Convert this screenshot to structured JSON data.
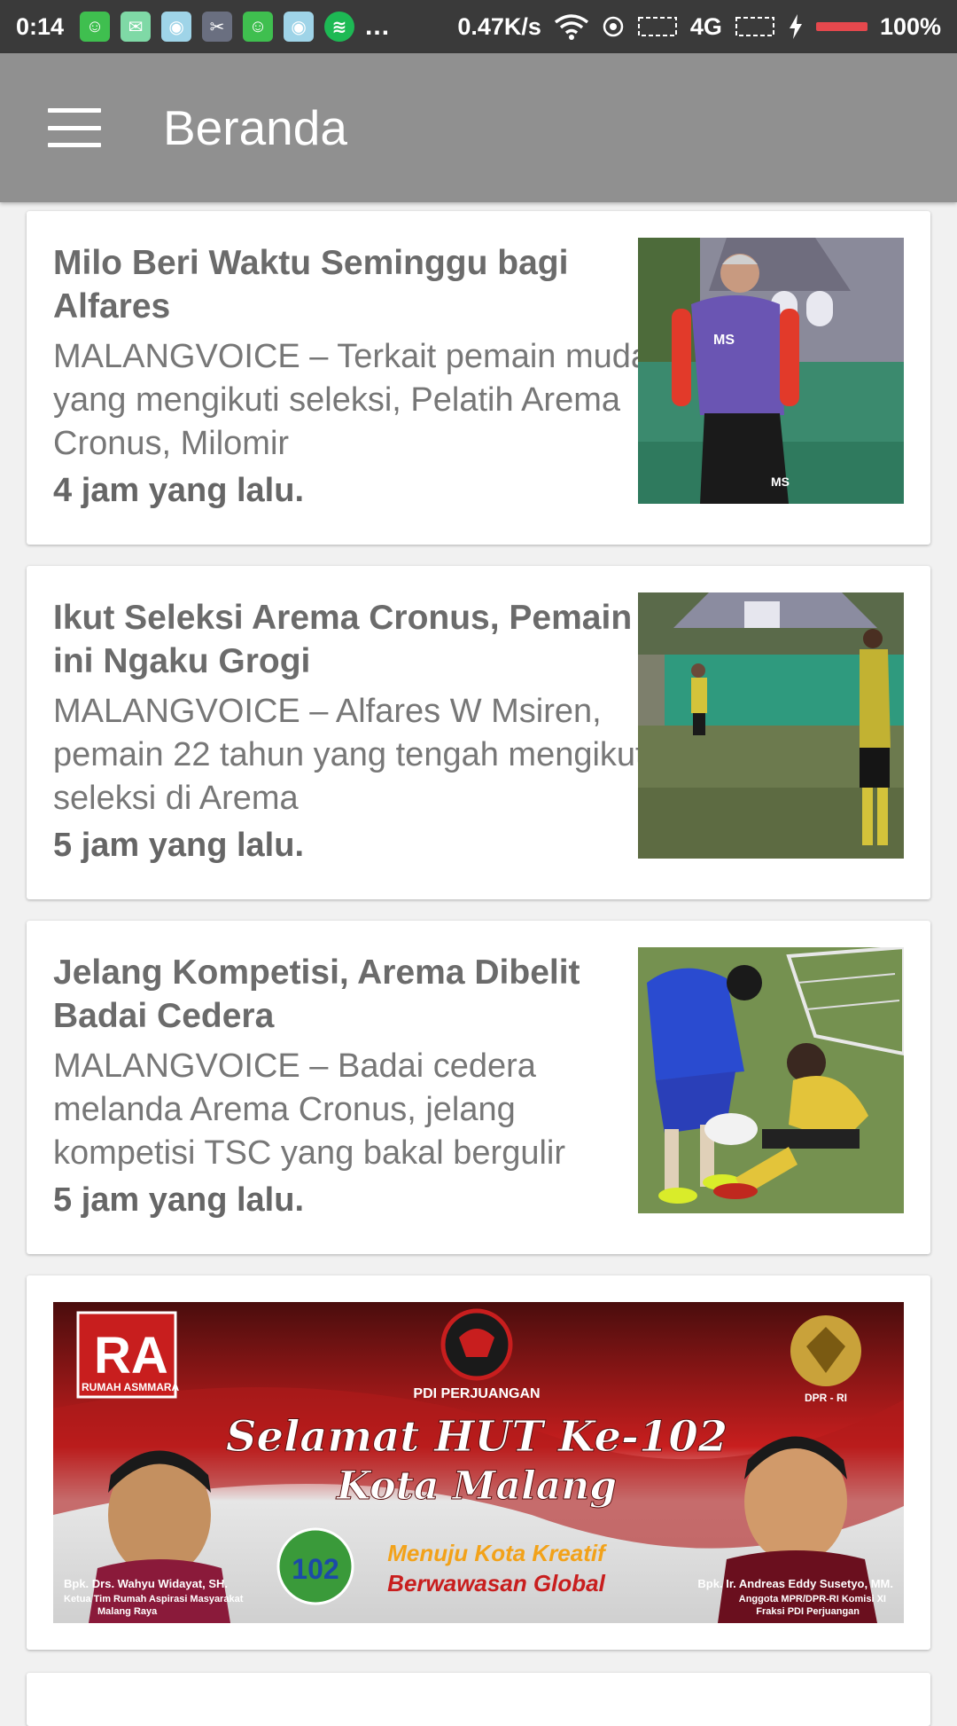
{
  "status_bar": {
    "time": "0:14",
    "net_speed": "0.47K/s",
    "network": "4G",
    "battery": "100%",
    "more": "..."
  },
  "app_bar": {
    "title": "Beranda"
  },
  "articles": [
    {
      "title": "Milo Beri Waktu Seminggu bagi Alfares",
      "excerpt": "MALANGVOICE – Terkait pemain muda yang mengikuti seleksi, Pelatih Arema Cronus, Milomir",
      "time": "4 jam yang lalu."
    },
    {
      "title": "Ikut Seleksi Arema Cronus, Pemain ini Ngaku Grogi",
      "excerpt": "MALANGVOICE – Alfares W Msiren, pemain 22 tahun yang tengah mengikuti seleksi di Arema",
      "time": "5 jam yang lalu."
    },
    {
      "title": "Jelang Kompetisi, Arema Dibelit Badai Cedera",
      "excerpt": "MALANGVOICE – Badai cedera melanda Arema Cronus, jelang kompetisi TSC yang bakal bergulir",
      "time": "5 jam yang lalu."
    }
  ],
  "banner": {
    "logo_text": "RUMAH ASMMARA",
    "party": "PDI PERJUANGAN",
    "emblem": "DPR - RI",
    "headline1": "Selamat HUT Ke-102",
    "headline2": "Kota Malang",
    "tagline1": "Menuju Kota Kreatif",
    "tagline2": "Berwawasan Global",
    "left_name": "Bpk. Drs. Wahyu Widayat, SH.",
    "left_role1": "Ketua Tim Rumah Aspirasi Masyarakat",
    "left_role2": "Malang Raya",
    "right_name": "Bpk. Ir. Andreas Eddy Susetyo, MM.",
    "right_role1": "Anggota MPR/DPR-RI Komisi XI",
    "right_role2": "Fraksi PDI Perjuangan"
  },
  "colors": {
    "app_bar": "#909090",
    "status_bar": "#3a3a3a",
    "background": "#f1f1f1",
    "banner_red": "#c81e1e"
  }
}
